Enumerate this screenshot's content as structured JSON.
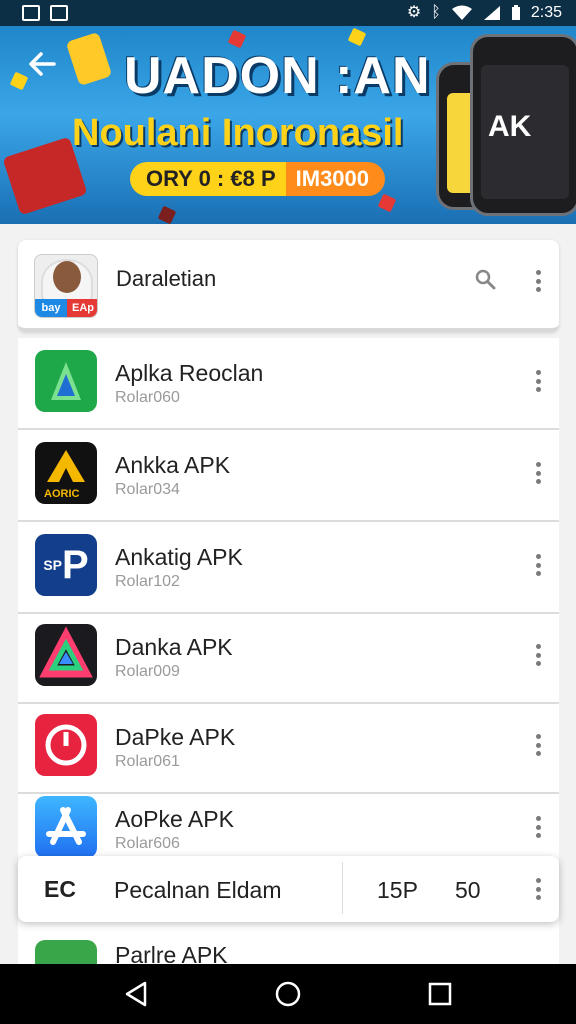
{
  "status_bar": {
    "time": "2:35",
    "left_icons": [
      "gallery-icon",
      "image-icon"
    ],
    "right_icons": [
      "settings-gear-icon",
      "bluetooth-icon",
      "wifi-icon",
      "signal-icon",
      "battery-icon"
    ]
  },
  "banner": {
    "title": "UADON :AN",
    "subtitle": "Noulani Inoronasil",
    "promo_left": "ORY 0 : €8 P",
    "promo_right": "IM3000",
    "phone_badge": "AK"
  },
  "header": {
    "title": "Daraletian",
    "avatar_left": "bay",
    "avatar_right": "EAp"
  },
  "apps": [
    {
      "name": "Aplka Reoclan",
      "sub": "Rolar060",
      "icon": "green-play-icon",
      "color": "#1fa84a"
    },
    {
      "name": "Ankka APK",
      "sub": "Rolar034",
      "icon": "yellow-a-icon",
      "color": "#111111",
      "badge": "AORIC"
    },
    {
      "name": "Ankatig APK",
      "sub": "Rolar102",
      "icon": "p-letter-icon",
      "color": "#123e8c",
      "badge": "SP"
    },
    {
      "name": "Danka APK",
      "sub": "Rolar009",
      "icon": "rainbow-a-icon",
      "color": "#1b1b1f"
    },
    {
      "name": "DaPke APK",
      "sub": "Rolar061",
      "icon": "red-power-icon",
      "color": "#e8233f"
    },
    {
      "name": "AoPke APK",
      "sub": "Rolar606",
      "icon": "app-store-icon",
      "color": "#1f8ef1"
    },
    {
      "name": "Parlre APK",
      "sub": "",
      "icon": "green-play-icon",
      "color": "#3aa64a"
    }
  ],
  "bottom_bar": {
    "left": "EC",
    "text": "Pecalnan Eldam",
    "num1": "15P",
    "num2": "50"
  },
  "colors": {
    "status_bar": "#0c2f46",
    "banner": "#2a95d8",
    "accent_yellow": "#ffd21a",
    "accent_orange": "#ff8c1a"
  }
}
